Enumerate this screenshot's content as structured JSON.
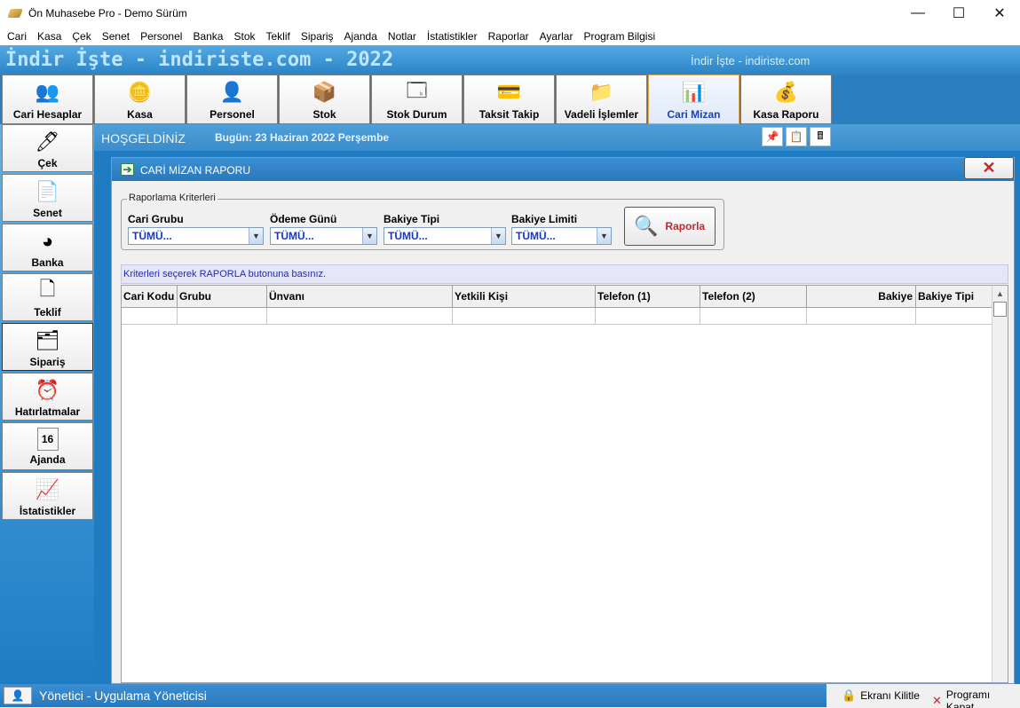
{
  "window": {
    "title": "Ön Muhasebe Pro - Demo Sürüm",
    "controls": {
      "minimize": "—",
      "maximize": "☐",
      "close": "✕"
    }
  },
  "menu": [
    "Cari",
    "Kasa",
    "Çek",
    "Senet",
    "Personel",
    "Banka",
    "Stok",
    "Teklif",
    "Sipariş",
    "Ajanda",
    "Notlar",
    "İstatistikler",
    "Raporlar",
    "Ayarlar",
    "Program Bilgisi"
  ],
  "banner": {
    "title": "İndir İşte - indiriste.com - 2022",
    "subtitle": "İndir İşte - indiriste.com"
  },
  "toolbar": [
    {
      "label": "Cari Hesaplar",
      "icon": "users-icon"
    },
    {
      "label": "Kasa",
      "icon": "coins-icon"
    },
    {
      "label": "Personel",
      "icon": "person-icon"
    },
    {
      "label": "Stok",
      "icon": "box-icon"
    },
    {
      "label": "Stok Durum",
      "icon": "window-icon"
    },
    {
      "label": "Taksit Takip",
      "icon": "card-icon"
    },
    {
      "label": "Vadeli İşlemler",
      "icon": "folder-icon"
    },
    {
      "label": "Cari Mizan",
      "icon": "chart-doc-icon",
      "active": true
    },
    {
      "label": "Kasa Raporu",
      "icon": "money-bag-icon"
    }
  ],
  "sidebar": [
    {
      "label": "Çek",
      "icon": "check-icon"
    },
    {
      "label": "Senet",
      "icon": "note-icon"
    },
    {
      "label": "Banka",
      "icon": "pie-icon"
    },
    {
      "label": "Teklif",
      "icon": "page-icon"
    },
    {
      "label": "Sipariş",
      "icon": "order-icon",
      "active": true
    },
    {
      "label": "Hatırlatmalar",
      "icon": "clock-icon"
    },
    {
      "label": "Ajanda",
      "icon": "calendar-icon",
      "day": "16"
    },
    {
      "label": "İstatistikler",
      "icon": "stats-icon"
    }
  ],
  "welcome": {
    "greeting": "HOŞGELDİNİZ",
    "today": "Bugün: 23 Haziran 2022 Perşembe"
  },
  "panel": {
    "title": "CARİ MİZAN RAPORU",
    "close_glyph": "✕",
    "criteria_legend": "Raporlama Kriterleri",
    "fields": [
      {
        "label": "Cari Grubu",
        "value": "TÜMÜ..."
      },
      {
        "label": "Ödeme Günü",
        "value": "TÜMÜ..."
      },
      {
        "label": "Bakiye Tipi",
        "value": "TÜMÜ..."
      },
      {
        "label": "Bakiye Limiti",
        "value": "TÜMÜ..."
      }
    ],
    "report_button": "Raporla",
    "hint": "Kriterleri seçerek RAPORLA butonuna basınız.",
    "columns": [
      "Cari Kodu",
      "Grubu",
      "Ünvanı",
      "Yetkili Kişi",
      "Telefon (1)",
      "Telefon (2)",
      "Bakiye",
      "Bakiye Tipi"
    ]
  },
  "status": {
    "user": "Yönetici - Uygulama Yöneticisi",
    "lock": "Ekranı Kilitle",
    "exit": "Programı Kapat"
  },
  "colors": {
    "accent_blue": "#2c7fbf",
    "banner_text": "#bfe6ff",
    "report_red": "#c0282d",
    "combo_value": "#1838c0"
  }
}
